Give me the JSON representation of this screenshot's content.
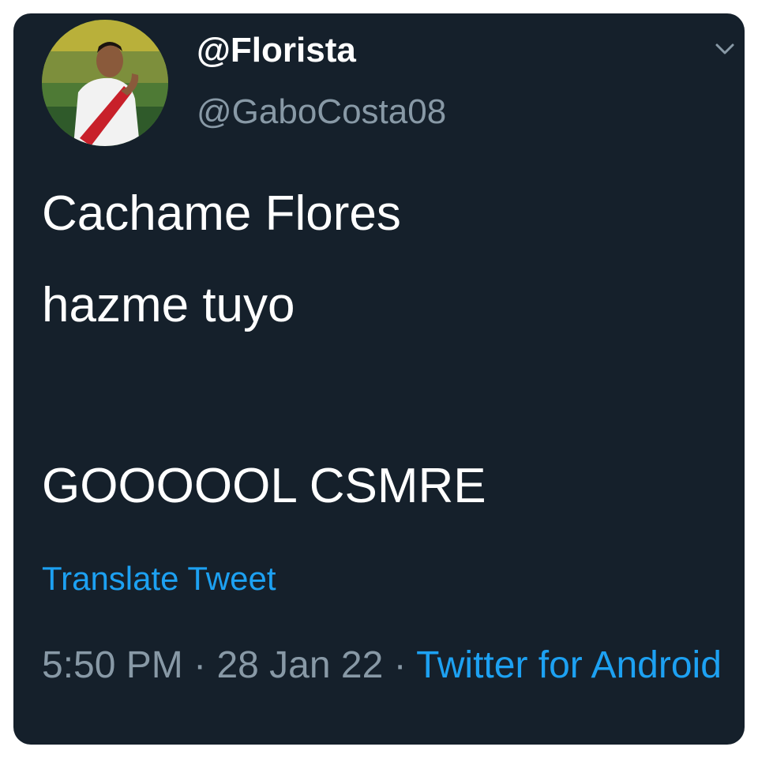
{
  "tweet": {
    "display_name": "@Florista",
    "handle": "@GaboCosta08",
    "text_lines": [
      "Cachame Flores",
      "hazme tuyo",
      "GOOOOOL CSMRE"
    ],
    "translate_label": "Translate Tweet",
    "time": "5:50 PM",
    "separator": "·",
    "date": "28 Jan 22",
    "source": "Twitter for Android"
  },
  "icons": {
    "menu": "chevron-down-icon",
    "avatar": "avatar-photo"
  },
  "colors": {
    "background": "#15202b",
    "text": "#ffffff",
    "muted": "#8899a6",
    "link": "#1da1f2"
  }
}
